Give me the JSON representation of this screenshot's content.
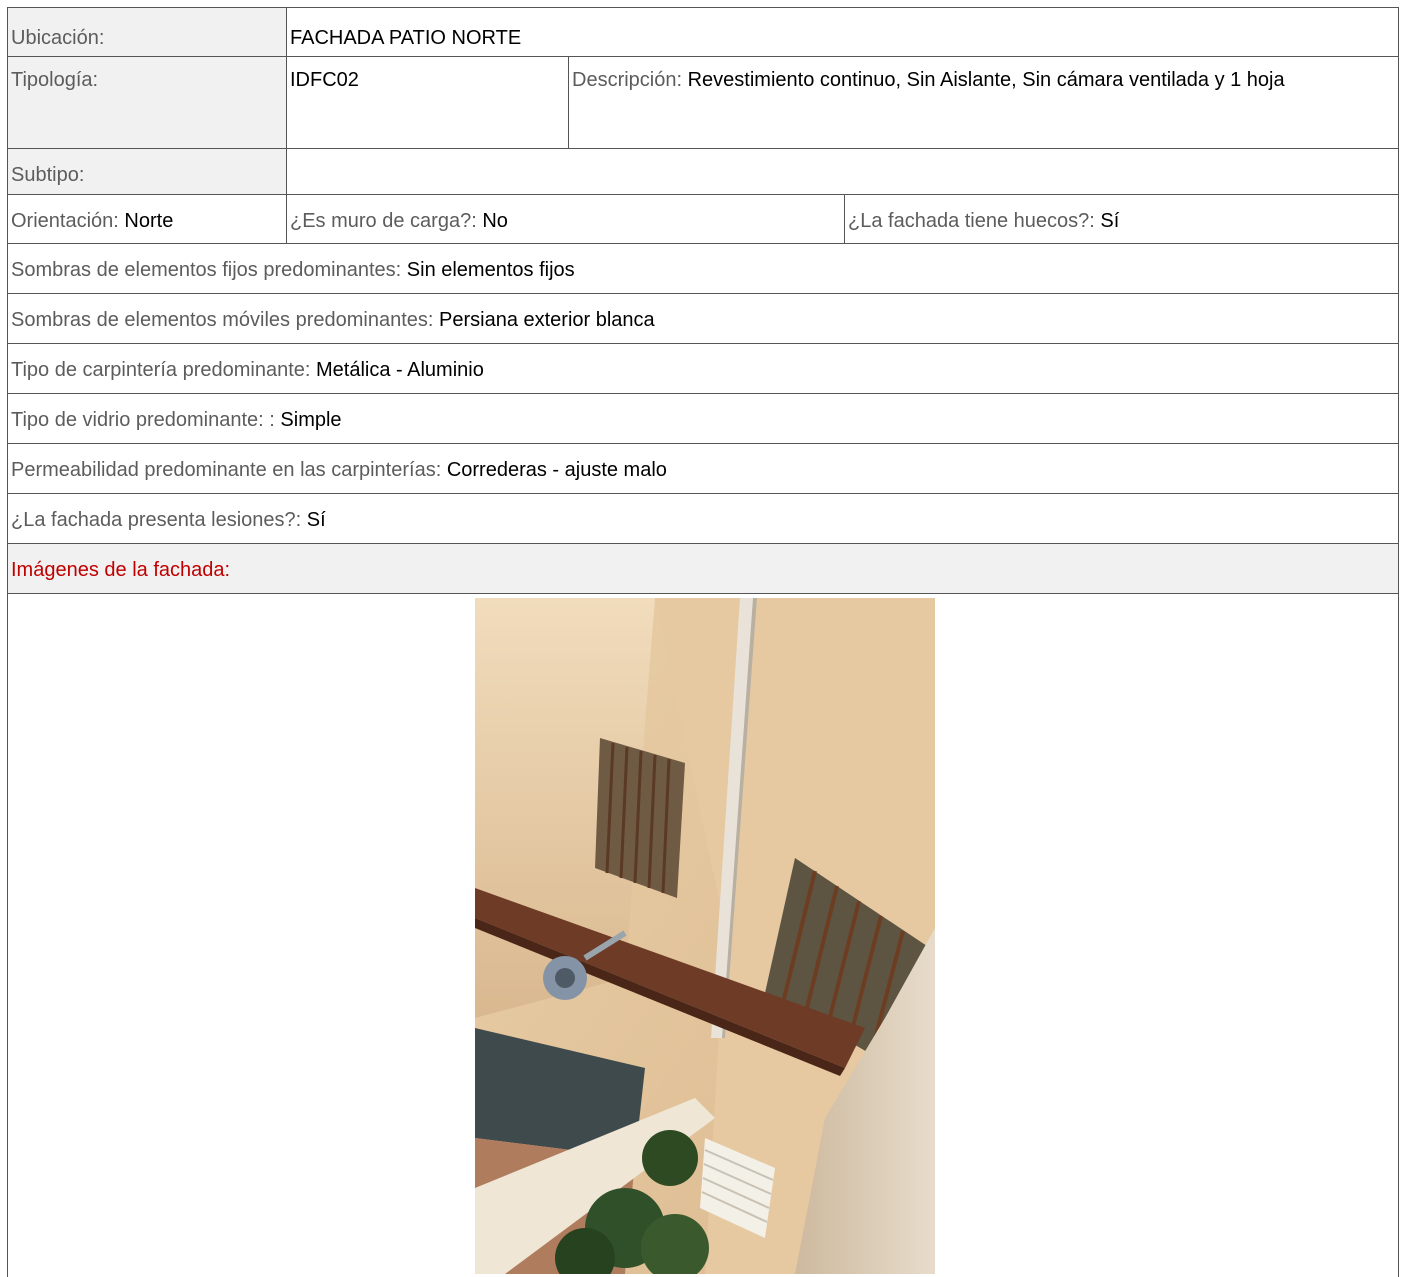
{
  "ubicacion": {
    "label": "Ubicación:",
    "value": "FACHADA PATIO NORTE"
  },
  "tipologia": {
    "label": "Tipología:",
    "value": "IDFC02"
  },
  "descripcion": {
    "label": "Descripción:",
    "value": "Revestimiento continuo, Sin Aislante, Sin cámara ventilada y 1 hoja"
  },
  "subtipo": {
    "label": "Subtipo:",
    "value": ""
  },
  "orientacion": {
    "label": "Orientación:",
    "value": "Norte"
  },
  "muro_carga": {
    "label": "¿Es muro de carga?:",
    "value": "No"
  },
  "huecos": {
    "label": "¿La fachada tiene huecos?:",
    "value": "Sí"
  },
  "sombras_fijos": {
    "label": "Sombras de elementos fijos predominantes:",
    "value": "Sin elementos fijos"
  },
  "sombras_moviles": {
    "label": "Sombras de elementos móviles predominantes:",
    "value": "Persiana exterior blanca"
  },
  "carpinteria": {
    "label": "Tipo de carpintería predominante:",
    "value": "Metálica - Aluminio"
  },
  "vidrio": {
    "label": "Tipo de vidrio predominante: :",
    "value": "Simple"
  },
  "permeabilidad": {
    "label": "Permeabilidad predominante en las carpinterías:",
    "value": "Correderas - ajuste malo"
  },
  "lesiones": {
    "label": "¿La fachada presenta lesiones?:",
    "value": "Sí"
  },
  "imagenes": {
    "label": "Imágenes de la fachada:"
  }
}
